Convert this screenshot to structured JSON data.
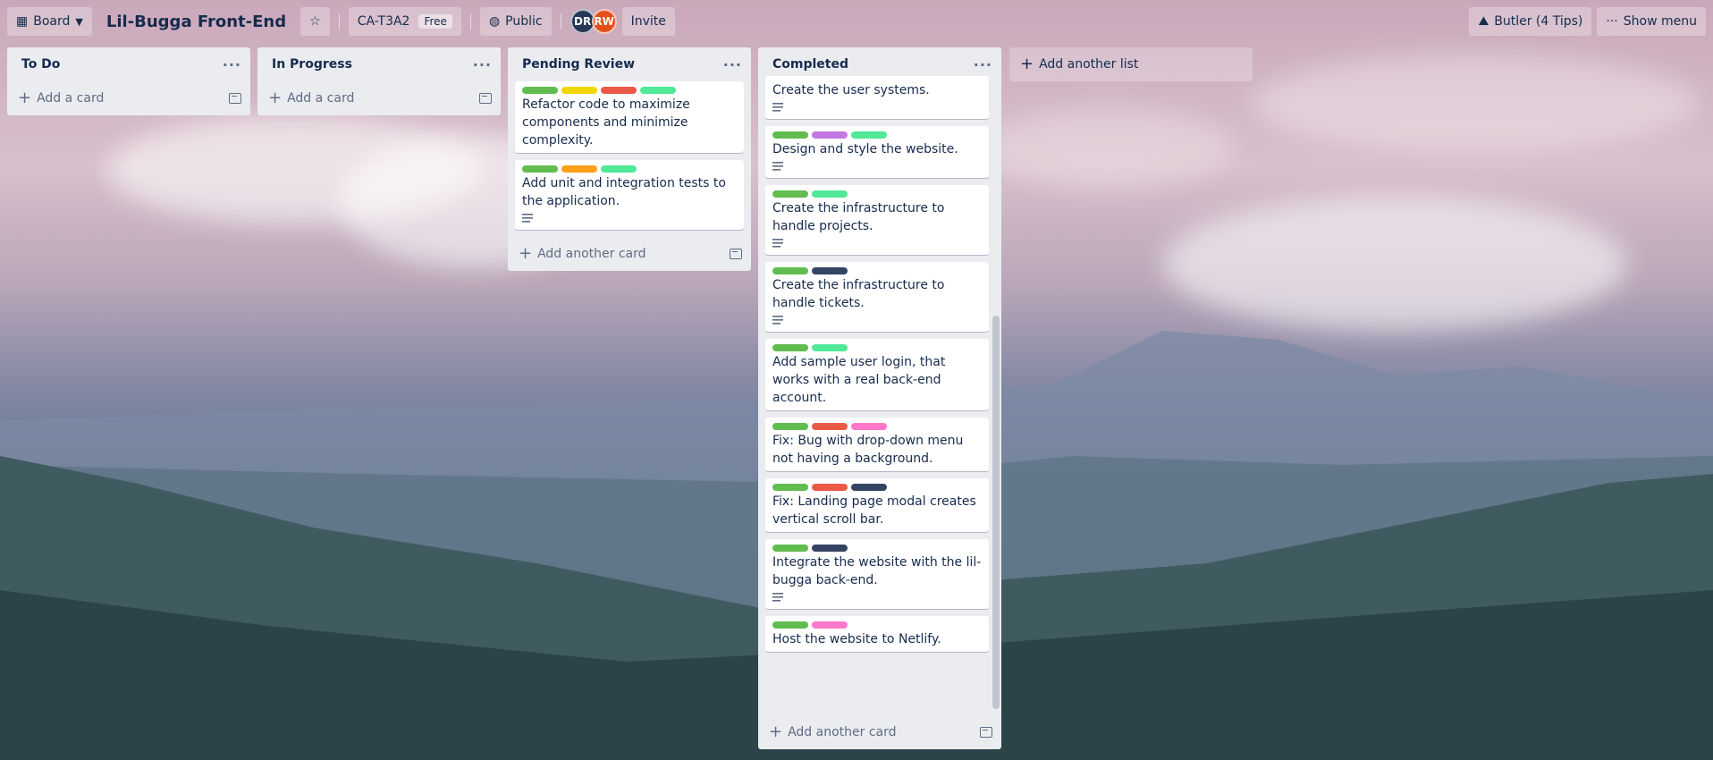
{
  "header": {
    "board_switcher": "Board",
    "title": "Lil-Bugga Front-End",
    "workspace": "CA-T3A2",
    "workspace_badge": "Free",
    "visibility": "Public",
    "members": [
      {
        "initials": "DR",
        "color": "#253858"
      },
      {
        "initials": "RW",
        "color": "#e4501c"
      }
    ],
    "invite": "Invite",
    "butler": "Butler (4 Tips)",
    "show_menu": "Show menu"
  },
  "labels": {
    "green": "#61bd4f",
    "yellow": "#f2d600",
    "red": "#eb5a46",
    "lime": "#51e898",
    "orange": "#ff9f1a",
    "purple": "#c377e0",
    "navy": "#344563",
    "pink": "#ff78cb"
  },
  "lists": [
    {
      "title": "To Do",
      "add_card": "Add a card",
      "cards": []
    },
    {
      "title": "In Progress",
      "add_card": "Add a card",
      "cards": []
    },
    {
      "title": "Pending Review",
      "add_card": "Add another card",
      "cards": [
        {
          "labels": [
            "green",
            "yellow",
            "red",
            "lime"
          ],
          "text": "Refactor code to maximize components and minimize complexity.",
          "has_description": false
        },
        {
          "labels": [
            "green",
            "orange",
            "lime"
          ],
          "text": "Add unit and integration tests to the application.",
          "has_description": true
        }
      ]
    },
    {
      "title": "Completed",
      "add_card": "Add another card",
      "cards": [
        {
          "labels": [],
          "text": "Create the user systems.",
          "has_description": true
        },
        {
          "labels": [
            "green",
            "purple",
            "lime"
          ],
          "text": "Design and style the website.",
          "has_description": true
        },
        {
          "labels": [
            "green",
            "lime"
          ],
          "text": "Create the infrastructure to handle projects.",
          "has_description": true
        },
        {
          "labels": [
            "green",
            "navy"
          ],
          "text": "Create the infrastructure to handle tickets.",
          "has_description": true
        },
        {
          "labels": [
            "green",
            "lime"
          ],
          "text": "Add sample user login, that works with a real back-end account.",
          "has_description": false
        },
        {
          "labels": [
            "green",
            "red",
            "pink"
          ],
          "text": "Fix: Bug with drop-down menu not having a background.",
          "has_description": false
        },
        {
          "labels": [
            "green",
            "red",
            "navy"
          ],
          "text": "Fix: Landing page modal creates vertical scroll bar.",
          "has_description": false
        },
        {
          "labels": [
            "green",
            "navy"
          ],
          "text": "Integrate the website with the lil-bugga back-end.",
          "has_description": true
        },
        {
          "labels": [
            "green",
            "pink"
          ],
          "text": "Host the website to Netlify.",
          "has_description": false
        }
      ]
    }
  ],
  "add_list": "Add another list"
}
